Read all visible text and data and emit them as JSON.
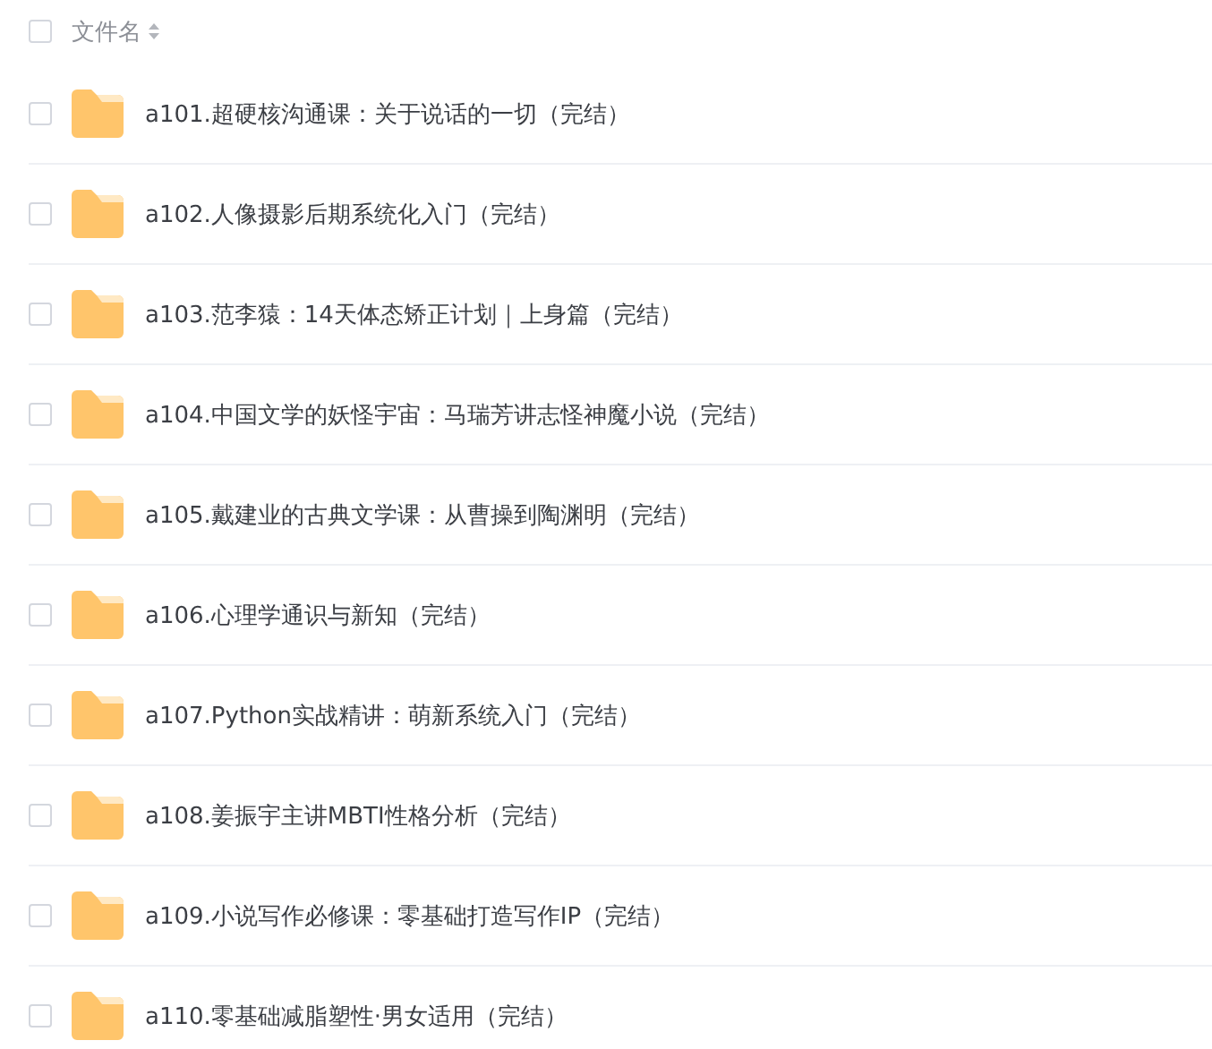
{
  "header": {
    "checked": false,
    "label": "文件名"
  },
  "files": [
    {
      "name": "a101.超硬核沟通课：关于说话的一切（完结）",
      "checked": false
    },
    {
      "name": "a102.人像摄影后期系统化入门（完结）",
      "checked": false
    },
    {
      "name": "a103.范李猿：14天体态矫正计划｜上身篇（完结）",
      "checked": false
    },
    {
      "name": "a104.中国文学的妖怪宇宙：马瑞芳讲志怪神魔小说（完结）",
      "checked": false
    },
    {
      "name": "a105.戴建业的古典文学课：从曹操到陶渊明（完结）",
      "checked": false
    },
    {
      "name": "a106.心理学通识与新知（完结）",
      "checked": false
    },
    {
      "name": "a107.Python实战精讲：萌新系统入门（完结）",
      "checked": false
    },
    {
      "name": "a108.姜振宇主讲MBTI性格分析（完结）",
      "checked": false
    },
    {
      "name": "a109.小说写作必修课：零基础打造写作IP（完结）",
      "checked": false
    },
    {
      "name": "a110.零基础减脂塑性·男女适用（完结）",
      "checked": false
    }
  ]
}
